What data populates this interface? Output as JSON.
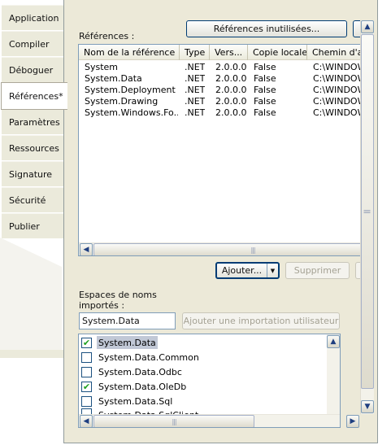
{
  "tabs": [
    {
      "label": "Application"
    },
    {
      "label": "Compiler"
    },
    {
      "label": "Déboguer"
    },
    {
      "label": "Références*"
    },
    {
      "label": "Paramètres"
    },
    {
      "label": "Ressources"
    },
    {
      "label": "Signature"
    },
    {
      "label": "Sécurité"
    },
    {
      "label": "Publier"
    }
  ],
  "references": {
    "label": "Références :",
    "unused_button": "Références inutilisées...",
    "columns": [
      "Nom de la référence",
      "Type",
      "Vers...",
      "Copie locale",
      "Chemin d'ac"
    ],
    "rows": [
      {
        "name": "System",
        "type": ".NET",
        "version": "2.0.0.0",
        "copy": "False",
        "path": "C:\\WINDOW"
      },
      {
        "name": "System.Data",
        "type": ".NET",
        "version": "2.0.0.0",
        "copy": "False",
        "path": "C:\\WINDOW"
      },
      {
        "name": "System.Deployment",
        "type": ".NET",
        "version": "2.0.0.0",
        "copy": "False",
        "path": "C:\\WINDOW"
      },
      {
        "name": "System.Drawing",
        "type": ".NET",
        "version": "2.0.0.0",
        "copy": "False",
        "path": "C:\\WINDOW"
      },
      {
        "name": "System.Windows.Fo...",
        "type": ".NET",
        "version": "2.0.0.0",
        "copy": "False",
        "path": "C:\\WINDOW"
      }
    ],
    "add_button": "Ajouter...",
    "remove_button": "Supprimer"
  },
  "imports": {
    "label_line1": "Espaces de noms",
    "label_line2": "importés :",
    "input_value": "System.Data",
    "add_import_button": "Ajouter une importation utilisateur",
    "items": [
      {
        "label": "System.Data",
        "checked": true,
        "selected": true
      },
      {
        "label": "System.Data.Common",
        "checked": false,
        "selected": false
      },
      {
        "label": "System.Data.Odbc",
        "checked": false,
        "selected": false
      },
      {
        "label": "System.Data.OleDb",
        "checked": true,
        "selected": false
      },
      {
        "label": "System.Data.Sql",
        "checked": false,
        "selected": false
      },
      {
        "label": "System.Data.SqlClient",
        "checked": false,
        "selected": false
      }
    ]
  },
  "colors": {
    "panel_bg": "#ece9d8",
    "border": "#7f9db9",
    "check": "#21a121"
  }
}
